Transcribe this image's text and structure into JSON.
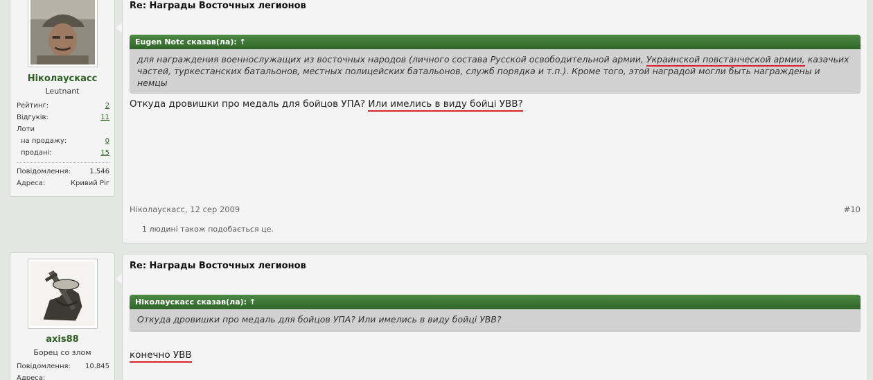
{
  "posts": [
    {
      "author": {
        "name": "Ніколаускасс",
        "title": "Leutnant",
        "avatar_icon": "soldier-photo-avatar",
        "stats": {
          "rating_label": "Рейтинг:",
          "rating": "2",
          "reviews_label": "Відгуків:",
          "reviews": "11",
          "lots_label": "Лоти",
          "for_sale_label": "на продажу:",
          "for_sale": "0",
          "sold_label": "продані:",
          "sold": "15",
          "messages_label": "Повідомлення:",
          "messages": "1.546",
          "address_label": "Адреса:",
          "address": "Кривий Ріг"
        }
      },
      "title": "Re: Награды Восточных легионов",
      "quote": {
        "header": "Eugen Notc сказав(ла): ↑",
        "text_before": "для награждения военнослужащих из восточных народов (личного состава Русской освободительной армии, ",
        "text_underlined": "Украинской повстанческой армии,",
        "text_after": " казачьих частей, туркестанских батальонов, местных полицейских батальонов, служб порядка и т.п.). Кроме того, этой наградой могли быть награждены и немцы"
      },
      "message_before": "Откуда дровишки про медаль для бойцов УПА? ",
      "message_underlined": "Или имелись в виду бойці УВВ?",
      "meta": "Ніколаускасс, 12 сер 2009",
      "post_number": "#10",
      "likes": "1 людині також подобається це."
    },
    {
      "author": {
        "name": "axis88",
        "title": "Борец со злом",
        "avatar_icon": "sword-emblem-avatar",
        "stats": {
          "messages_label": "Повідомлення:",
          "messages": "10.845",
          "address_label": "Адреса:"
        }
      },
      "title": "Re: Награды Восточных легионов",
      "quote": {
        "header": "Ніколаускасс сказав(ла): ↑",
        "text": "Откуда дровишки про медаль для бойцов УПА? Или имелись в виду бойці УВВ?"
      },
      "message_underlined": "конечно УВВ"
    }
  ],
  "colors": {
    "page_bg": "#e4e6e4",
    "panel_bg": "#f3f4f3",
    "quote_header": "#3c7534",
    "quote_body": "#d0d1d0",
    "username": "#2d5f23",
    "annotation_underline": "#d8232a"
  }
}
